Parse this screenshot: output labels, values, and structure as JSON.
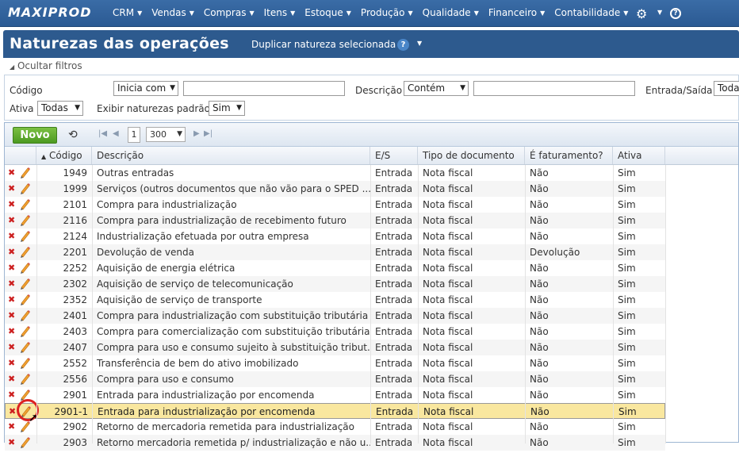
{
  "app": {
    "logo": "MAXIPROD"
  },
  "menu": [
    {
      "label": "CRM"
    },
    {
      "label": "Vendas"
    },
    {
      "label": "Compras"
    },
    {
      "label": "Itens"
    },
    {
      "label": "Estoque"
    },
    {
      "label": "Produção"
    },
    {
      "label": "Qualidade"
    },
    {
      "label": "Financeiro"
    },
    {
      "label": "Contabilidade"
    }
  ],
  "header": {
    "title": "Naturezas das operações",
    "duplicate_label": "Duplicar natureza selecionada",
    "help_glyph": "?"
  },
  "filters": {
    "toggle_label": "Ocultar filtros",
    "codigo_label": "Código",
    "codigo_mode": "Inicia com",
    "codigo_value": "",
    "descricao_label": "Descrição",
    "descricao_mode": "Contém",
    "descricao_value": "",
    "es_label": "Entrada/Saída",
    "es_value": "Toda",
    "ativa_label": "Ativa",
    "ativa_value": "Todas",
    "padrao_label": "Exibir naturezas padrão",
    "padrao_value": "Sim"
  },
  "toolbar": {
    "new_label": "Novo",
    "page": "1",
    "page_size": "300"
  },
  "columns": [
    "Código",
    "Descrição",
    "E/S",
    "Tipo de documento",
    "É faturamento?",
    "Ativa"
  ],
  "rows": [
    {
      "code": "1949",
      "desc": "Outras entradas",
      "es": "Entrada",
      "tipo": "Nota fiscal",
      "fat": "Não",
      "ativa": "Sim"
    },
    {
      "code": "1999",
      "desc": "Serviços (outros documentos que não vão para o SPED ...",
      "es": "Entrada",
      "tipo": "Nota fiscal",
      "fat": "Não",
      "ativa": "Sim"
    },
    {
      "code": "2101",
      "desc": "Compra para industrialização",
      "es": "Entrada",
      "tipo": "Nota fiscal",
      "fat": "Não",
      "ativa": "Sim"
    },
    {
      "code": "2116",
      "desc": "Compra para industrialização de recebimento futuro",
      "es": "Entrada",
      "tipo": "Nota fiscal",
      "fat": "Não",
      "ativa": "Sim"
    },
    {
      "code": "2124",
      "desc": "Industrialização efetuada por outra empresa",
      "es": "Entrada",
      "tipo": "Nota fiscal",
      "fat": "Não",
      "ativa": "Sim"
    },
    {
      "code": "2201",
      "desc": "Devolução de venda",
      "es": "Entrada",
      "tipo": "Nota fiscal",
      "fat": "Devolução",
      "ativa": "Sim"
    },
    {
      "code": "2252",
      "desc": "Aquisição de energia elétrica",
      "es": "Entrada",
      "tipo": "Nota fiscal",
      "fat": "Não",
      "ativa": "Sim"
    },
    {
      "code": "2302",
      "desc": "Aquisição de serviço de telecomunicação",
      "es": "Entrada",
      "tipo": "Nota fiscal",
      "fat": "Não",
      "ativa": "Sim"
    },
    {
      "code": "2352",
      "desc": "Aquisição de serviço de transporte",
      "es": "Entrada",
      "tipo": "Nota fiscal",
      "fat": "Não",
      "ativa": "Sim"
    },
    {
      "code": "2401",
      "desc": "Compra para industrialização com substituição tributária",
      "es": "Entrada",
      "tipo": "Nota fiscal",
      "fat": "Não",
      "ativa": "Sim"
    },
    {
      "code": "2403",
      "desc": "Compra para comercialização com substituição tributária",
      "es": "Entrada",
      "tipo": "Nota fiscal",
      "fat": "Não",
      "ativa": "Sim"
    },
    {
      "code": "2407",
      "desc": "Compra para uso e consumo sujeito à substituição tribut...",
      "es": "Entrada",
      "tipo": "Nota fiscal",
      "fat": "Não",
      "ativa": "Sim"
    },
    {
      "code": "2552",
      "desc": "Transferência de bem do ativo imobilizado",
      "es": "Entrada",
      "tipo": "Nota fiscal",
      "fat": "Não",
      "ativa": "Sim"
    },
    {
      "code": "2556",
      "desc": "Compra para uso e consumo",
      "es": "Entrada",
      "tipo": "Nota fiscal",
      "fat": "Não",
      "ativa": "Sim"
    },
    {
      "code": "2901",
      "desc": "Entrada para industrialização por encomenda",
      "es": "Entrada",
      "tipo": "Nota fiscal",
      "fat": "Não",
      "ativa": "Sim"
    },
    {
      "code": "2901-1",
      "desc": "Entrada para industrialização por encomenda",
      "es": "Entrada",
      "tipo": "Nota fiscal",
      "fat": "Não",
      "ativa": "Sim",
      "selected": true
    },
    {
      "code": "2902",
      "desc": "Retorno de mercadoria remetida para industrialização",
      "es": "Entrada",
      "tipo": "Nota fiscal",
      "fat": "Não",
      "ativa": "Sim"
    },
    {
      "code": "2903",
      "desc": "Retorno mercadoria remetida p/ industrialização e não u...",
      "es": "Entrada",
      "tipo": "Nota fiscal",
      "fat": "Não",
      "ativa": "Sim"
    }
  ],
  "colors": {
    "accent": "#2d5a8e",
    "selected_row": "#f9e79f",
    "new_button": "#5ba82e"
  }
}
